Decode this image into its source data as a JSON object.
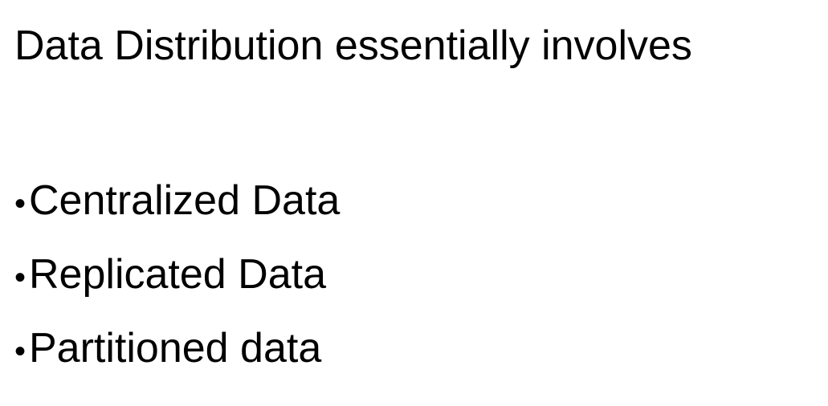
{
  "slide": {
    "title": "Data Distribution essentially involves",
    "bullet_char": "•",
    "bullets": [
      "Centralized Data",
      "Replicated Data",
      "Partitioned data"
    ]
  }
}
